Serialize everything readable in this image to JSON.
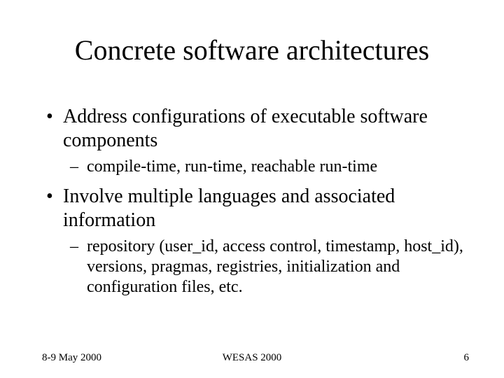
{
  "title": "Concrete software architectures",
  "bullets": [
    {
      "text": "Address configurations of executable software components",
      "sub": [
        "compile-time, run-time, reachable run-time"
      ]
    },
    {
      "text": "Involve multiple languages and associated information",
      "sub": [
        "repository (user_id, access control, timestamp, host_id), versions, pragmas, registries, initialization and configuration files, etc."
      ]
    }
  ],
  "footer": {
    "date": "8-9 May 2000",
    "event": "WESAS 2000",
    "page": "6"
  }
}
